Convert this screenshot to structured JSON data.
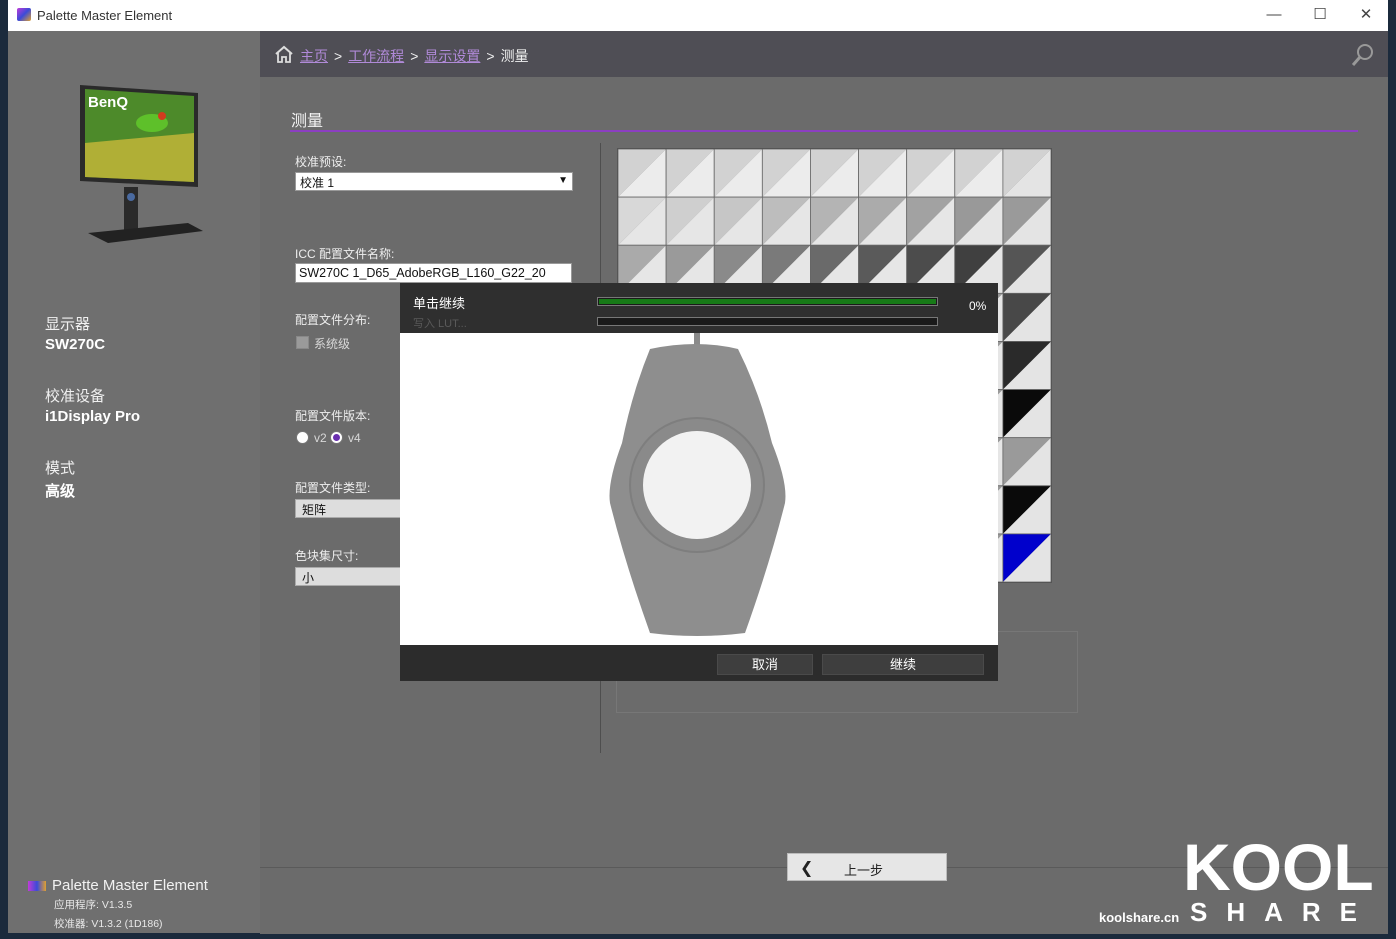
{
  "window": {
    "title": "Palette Master Element",
    "icon": "app-palette-icon"
  },
  "sidebar": {
    "display_label": "显示器",
    "display_value": "SW270C",
    "device_label": "校准设备",
    "device_value": "i1Display Pro",
    "mode_label": "模式",
    "mode_value": "高级",
    "brand": "Palette Master Element",
    "app_version": "应用程序:  V1.3.5",
    "cal_version": "校准器:  V1.3.2 (1D186)",
    "monitor_logo": "BenQ"
  },
  "breadcrumb": {
    "home_icon": "home-icon",
    "items": [
      "主页",
      "工作流程",
      "显示设置"
    ],
    "sep": ">",
    "current": "测量"
  },
  "main": {
    "section_title": "测量",
    "preset_label": "校准预设:",
    "preset_value": "校准 1",
    "icc_label": "ICC 配置文件名称:",
    "icc_value": "SW270C 1_D65_AdobeRGB_L160_G22_20",
    "dist_label": "配置文件分布:",
    "dist_option": "系统级",
    "version_label": "配置文件版本:",
    "version_v2": "v2",
    "version_v4": "v4",
    "type_label": "配置文件类型:",
    "type_value": "矩阵",
    "patch_label": "色块集尺寸:",
    "patch_value": "小"
  },
  "dialog": {
    "title": "单击继续",
    "subtitle": "写入 LUT...",
    "progress_percent": "0%",
    "progress_fill": 1.0,
    "cancel": "取消",
    "continue": "继续"
  },
  "footer": {
    "back": "上一步"
  },
  "watermark": {
    "site": "koolshare.cn",
    "share": "SHARE",
    "kool": "KOOL"
  },
  "colors": {
    "accent": "#8c3fc2",
    "link": "#b08ad8",
    "progress": "#177a17"
  }
}
